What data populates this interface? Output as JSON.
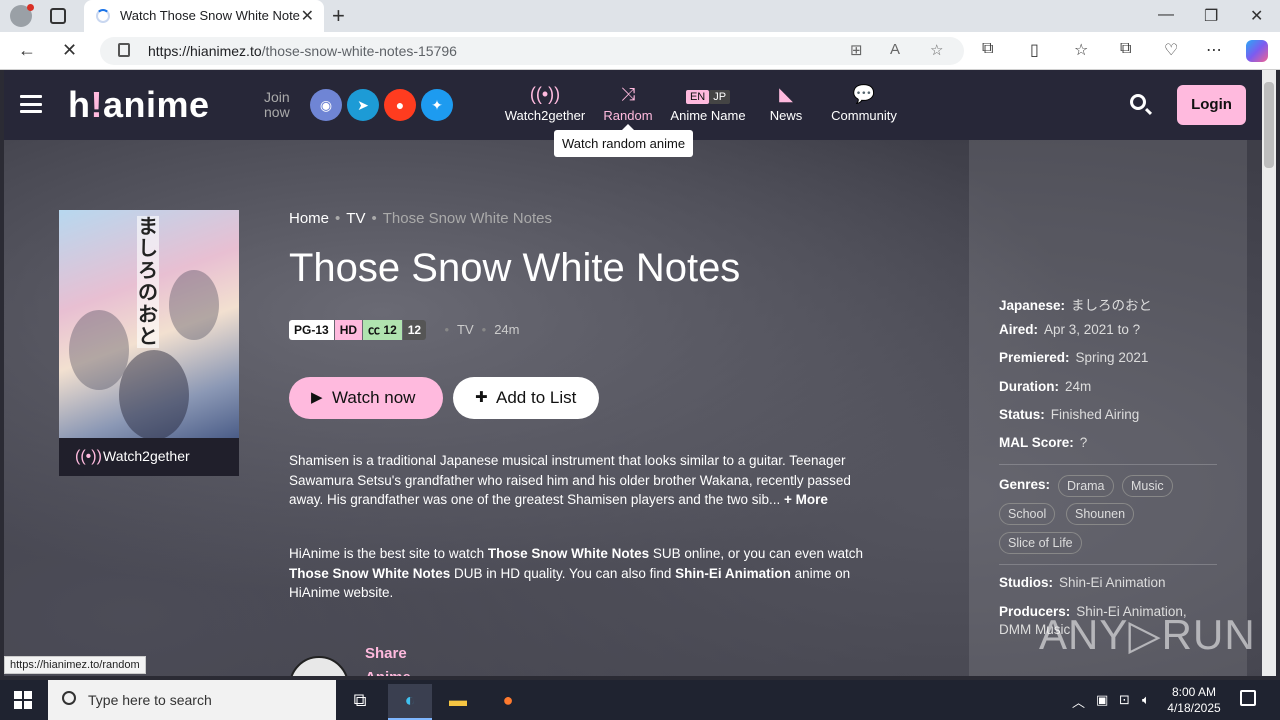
{
  "browser": {
    "tab_title": "Watch Those Snow White Notes E",
    "url_domain": "https://hianimez.to",
    "url_path": "/those-snow-white-notes-15796",
    "status_url": "https://hianimez.to/random"
  },
  "header": {
    "logo_main": "h",
    "logo_bang": "!",
    "logo_rest": "anime",
    "join_line1": "Join",
    "join_line2": "now",
    "menu": [
      {
        "label": "Watch2gether",
        "icon": "broadcast-icon"
      },
      {
        "label": "Random",
        "icon": "shuffle-icon"
      },
      {
        "label": "Anime Name",
        "icon": "language-toggle"
      },
      {
        "label": "News",
        "icon": "rss-icon"
      },
      {
        "label": "Community",
        "icon": "chat-icon"
      }
    ],
    "lang_en": "EN",
    "lang_jp": "JP",
    "tooltip": "Watch random anime",
    "login_label": "Login",
    "accent_color": "#ffbade"
  },
  "poster": {
    "jp_title": "ましろのおと",
    "watch2gether_label": "Watch2gether"
  },
  "breadcrumb": {
    "home": "Home",
    "type": "TV",
    "current": "Those Snow White Notes"
  },
  "anime": {
    "title": "Those Snow White Notes",
    "rating": "PG-13",
    "quality": "HD",
    "sub_count": "12",
    "eps_count": "12",
    "type": "TV",
    "duration": "24m",
    "watch_label": "Watch now",
    "add_label": "Add to List",
    "synopsis": "Shamisen is a traditional Japanese musical instrument that looks similar to a guitar. Teenager Sawamura Setsu's grandfather who raised him and his older brother Wakana, recently passed away. His grandfather was one of the greatest Shamisen players and the two sib...",
    "more_label": "+ More",
    "promo_1": "HiAnime is the best site to watch ",
    "promo_title1": "Those Snow White Notes",
    "promo_2": " SUB online, or you can even watch ",
    "promo_title2": "Those Snow White Notes",
    "promo_3": " DUB in HD quality. You can also find ",
    "promo_studio": "Shin-Ei Animation",
    "promo_4": " anime on HiAnime website.",
    "share_line1": "Share",
    "share_line2": "Anime"
  },
  "info": {
    "japanese_k": "Japanese:",
    "japanese_v": "ましろのおと",
    "aired_k": "Aired:",
    "aired_v": "Apr 3, 2021 to ?",
    "premiered_k": "Premiered:",
    "premiered_v": "Spring 2021",
    "duration_k": "Duration:",
    "duration_v": "24m",
    "status_k": "Status:",
    "status_v": "Finished Airing",
    "mal_k": "MAL Score:",
    "mal_v": "?",
    "genres_k": "Genres:",
    "genres": [
      "Drama",
      "Music",
      "School",
      "Shounen",
      "Slice of Life"
    ],
    "studios_k": "Studios:",
    "studios_v": "Shin-Ei Animation",
    "producers_k": "Producers:",
    "producers_v": "Shin-Ei Animation, DMM Music"
  },
  "watermark": "ANY▷RUN",
  "taskbar": {
    "search_placeholder": "Type here to search",
    "time": "8:00 AM",
    "date": "4/18/2025"
  }
}
